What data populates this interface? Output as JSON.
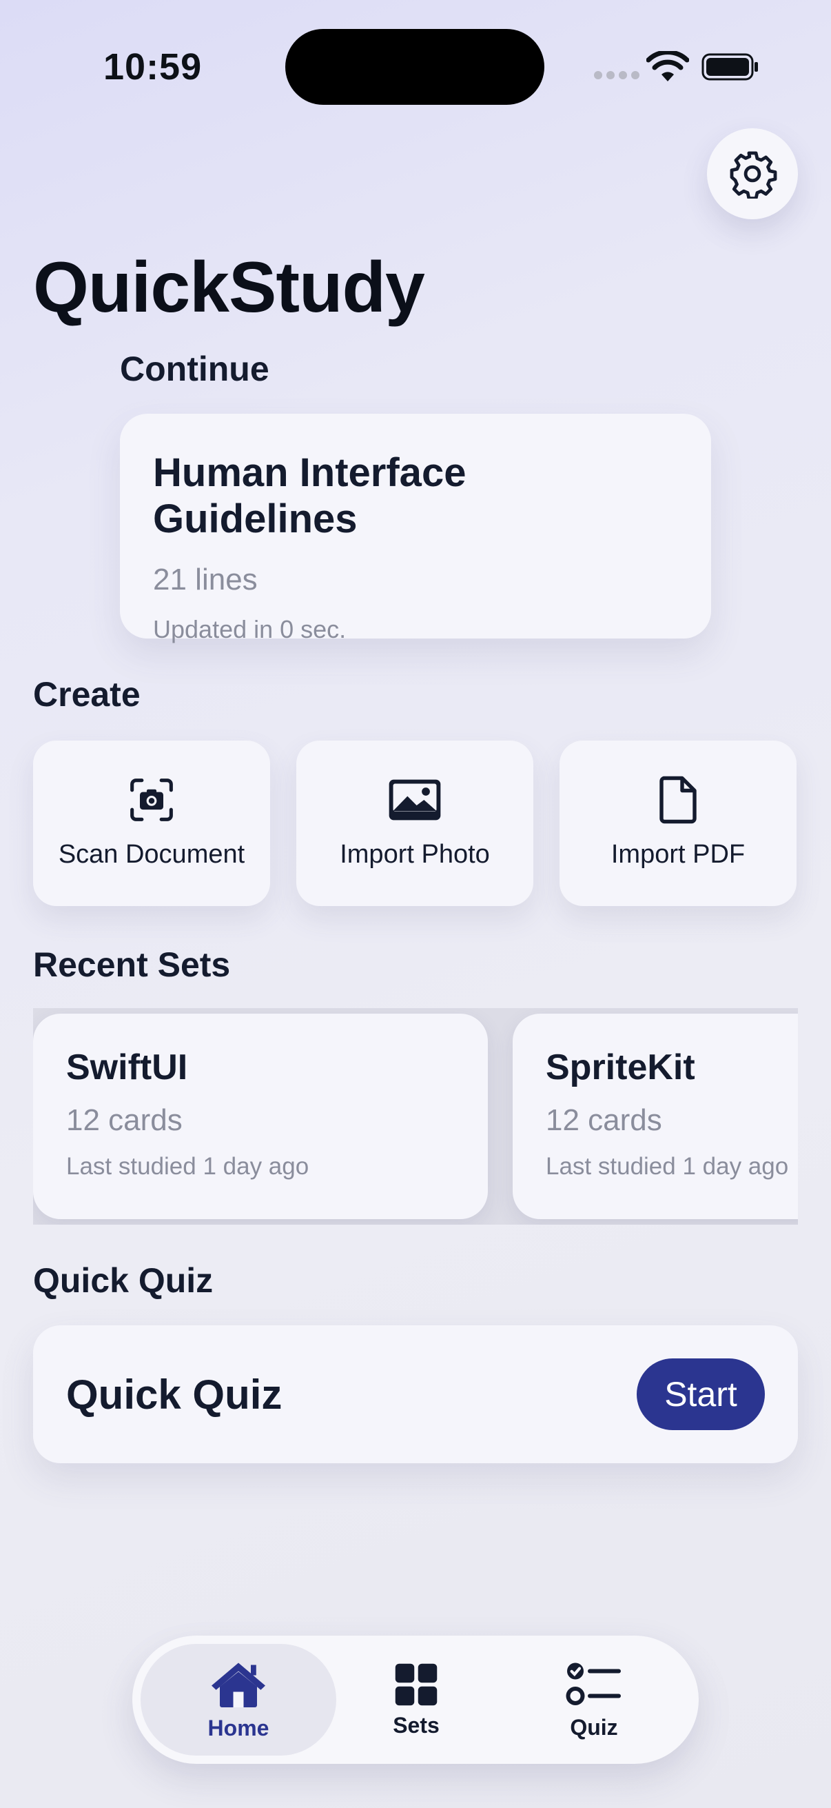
{
  "status_bar": {
    "time": "10:59"
  },
  "app": {
    "title": "QuickStudy"
  },
  "continue": {
    "heading": "Continue",
    "card": {
      "title": "Human Interface Guidelines",
      "lines": "21 lines",
      "updated": "Updated in 0 sec."
    }
  },
  "create": {
    "heading": "Create",
    "items": [
      {
        "label": "Scan Document",
        "icon": "camera-scan-icon"
      },
      {
        "label": "Import Photo",
        "icon": "photo-icon"
      },
      {
        "label": "Import PDF",
        "icon": "document-icon"
      }
    ]
  },
  "recent_sets": {
    "heading": "Recent Sets",
    "items": [
      {
        "title": "SwiftUI",
        "count": "12 cards",
        "last": "Last studied 1 day ago"
      },
      {
        "title": "SpriteKit",
        "count": "12 cards",
        "last": "Last studied 1 day ago"
      }
    ]
  },
  "quick_quiz": {
    "heading": "Quick Quiz",
    "card_title": "Quick Quiz",
    "start_label": "Start"
  },
  "tabbar": {
    "items": [
      {
        "label": "Home",
        "icon": "house-icon",
        "active": true
      },
      {
        "label": "Sets",
        "icon": "grid-icon",
        "active": false
      },
      {
        "label": "Quiz",
        "icon": "checklist-icon",
        "active": false
      }
    ]
  },
  "colors": {
    "accent": "#2b3590",
    "text": "#141b2e",
    "secondary_text": "#8a8d9c",
    "card": "#f5f5fb"
  }
}
